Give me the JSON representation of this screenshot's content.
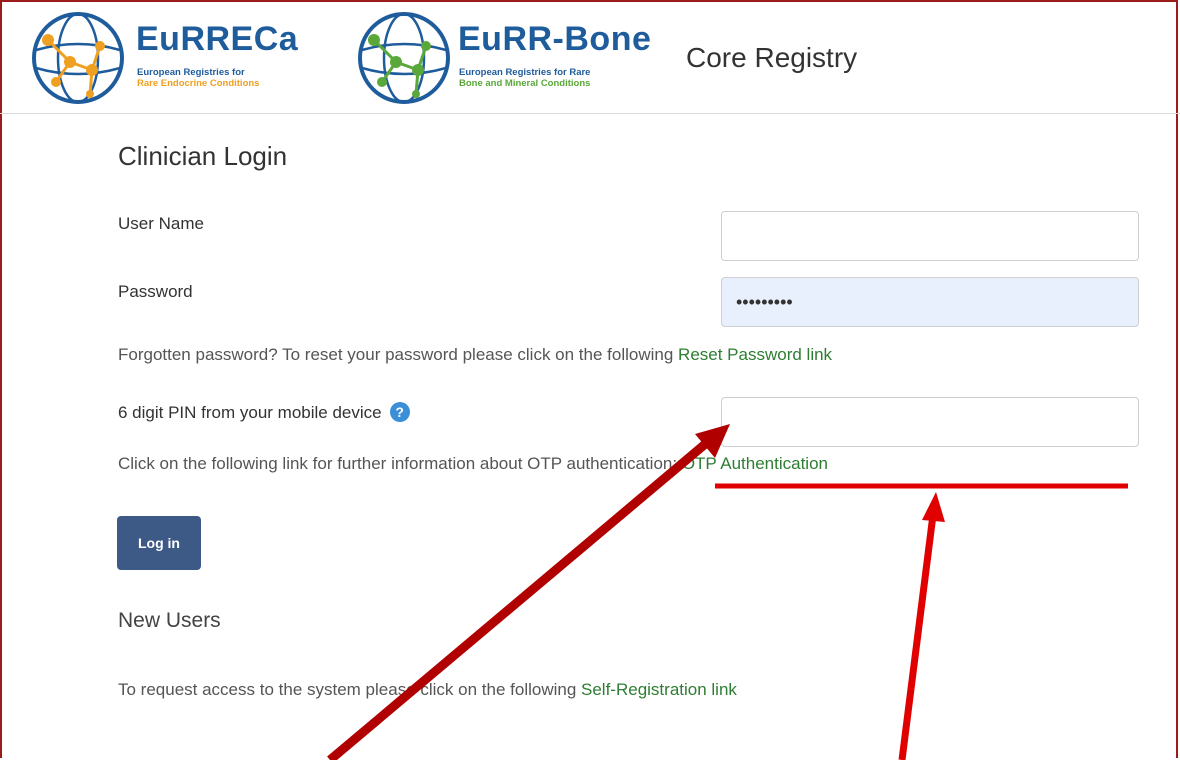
{
  "header": {
    "logo1": {
      "name": "EuRRECa",
      "sub_line1": "European Registries for",
      "sub_line2": "Rare Endocrine Conditions"
    },
    "logo2": {
      "name": "EuRR-Bone",
      "sub_line1": "European Registries for Rare",
      "sub_line2": "Bone and Mineral Conditions"
    },
    "title": "Core Registry"
  },
  "login": {
    "heading": "Clinician Login",
    "username_label": "User Name",
    "username_value": "",
    "password_label": "Password",
    "password_value": "•••••••••",
    "forgot_text": "Forgotten password? To reset your password please click on the following ",
    "forgot_link": "Reset Password link",
    "pin_label": "6 digit PIN from your mobile device",
    "help_icon": "?",
    "pin_value": "",
    "otp_text": "Click on the following link for further information about OTP authentication: ",
    "otp_link": "OTP Authentication",
    "login_button": "Log in"
  },
  "new_users": {
    "heading": "New Users",
    "text": "To request access to the system please click on the following ",
    "link": "Self-Registration link"
  },
  "colors": {
    "link": "#2e7d32",
    "button": "#3d5a87",
    "annotation": "#e00000",
    "arrow_dark": "#b00000"
  }
}
